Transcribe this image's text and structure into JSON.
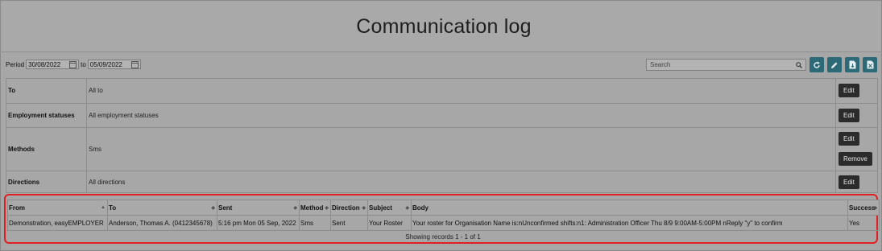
{
  "page": {
    "title": "Communication log"
  },
  "toolbar": {
    "period_label": "Period",
    "date_from": "30/08/2022",
    "to_label": "to",
    "date_to": "05/09/2022",
    "search_placeholder": "Search",
    "icons": [
      "refresh-icon",
      "edit-icon",
      "export-pdf-icon",
      "export-excel-icon"
    ]
  },
  "filters": [
    {
      "label": "To",
      "value": "All to",
      "buttons": [
        "Edit"
      ]
    },
    {
      "label": "Employment statuses",
      "value": "All employment statuses",
      "buttons": [
        "Edit"
      ]
    },
    {
      "label": "Methods",
      "value": "Sms",
      "buttons": [
        "Edit",
        "Remove"
      ]
    },
    {
      "label": "Directions",
      "value": "All directions",
      "buttons": [
        "Edit"
      ]
    }
  ],
  "table": {
    "columns": [
      "From",
      "To",
      "Sent",
      "Method",
      "Direction",
      "Subject",
      "Body",
      "Success"
    ],
    "rows": [
      [
        "Demonstration, easyEMPLOYER",
        "Anderson, Thomas A. (0412345678)",
        "5:16 pm Mon 05 Sep, 2022",
        "Sms",
        "Sent",
        "Your Roster",
        "Your roster for Organisation Name is:nUnconfirmed shifts:n1: Administration Officer Thu 8/9 9:00AM-5:00PM nReply \"y\" to confirm",
        "Yes"
      ]
    ],
    "footer": "Showing records 1 - 1 of 1"
  }
}
